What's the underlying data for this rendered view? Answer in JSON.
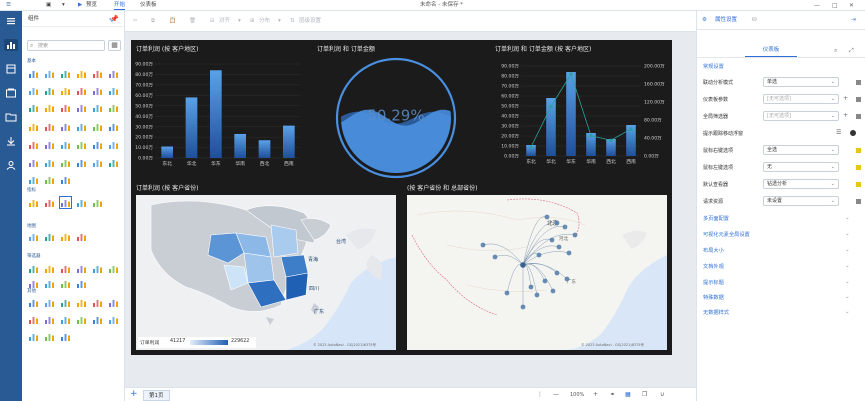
{
  "titlebar": {
    "menu": [
      "预览",
      "开始",
      "仪表板"
    ],
    "doc_title": "未命名 - 未保存 *",
    "window_controls": [
      "—",
      "□",
      "✕"
    ]
  },
  "left_rail": {
    "icons": [
      "menu-icon",
      "chart-icon",
      "dataset-icon",
      "schedule-icon",
      "folder-icon",
      "download-icon",
      "user-icon"
    ]
  },
  "components": {
    "title": "组件",
    "search_placeholder": "搜索",
    "sections": [
      "基本",
      "指标",
      "地图",
      "筛选器",
      "其他"
    ]
  },
  "toolbar": {
    "items": [
      "对齐",
      "分布",
      "层级设置"
    ]
  },
  "dashboard": {
    "colors": {
      "bg": "#1b1b1b",
      "bar": "#3f7fd6",
      "bar_light": "#5aa2e8",
      "line": "#2aa198",
      "water": "#4a90e0"
    },
    "chart_titles": {
      "c1": "订单利润 (按 客户地区)",
      "c2": "订单利润 和 订单金额",
      "c3": "订单利润 和 订单金额 (按 客户地区)",
      "c4": "订单利润 (按 客户省份)",
      "c5": "(按 客户省份 和 总部省份)"
    },
    "map_legend": {
      "label": "订单利润",
      "min": "41217",
      "max": "229622"
    },
    "map_attribution": "© 2023 AutoNavi - GS(2021)6375号",
    "map_labels": {
      "m1": [
        "青海",
        "四川",
        "广东",
        "台湾"
      ],
      "m2": [
        "北京",
        "河北",
        "广东"
      ]
    }
  },
  "chart_data": [
    {
      "type": "bar",
      "title": "订单利润 (按 客户地区)",
      "categories": [
        "东北",
        "华北",
        "华东",
        "华南",
        "西北",
        "西南"
      ],
      "yticks": [
        "0.00万",
        "10.00万",
        "20.00万",
        "30.00万",
        "40.00万",
        "50.00万",
        "60.00万",
        "70.00万",
        "80.00万",
        "90.00万"
      ],
      "values": [
        11,
        58,
        84,
        23,
        17,
        31
      ],
      "ylim": [
        0,
        90
      ]
    },
    {
      "type": "gauge",
      "title": "订单利润 和 订单金额",
      "value_label": "50.29%",
      "value": 0.5029
    },
    {
      "type": "bar",
      "title": "订单利润 和 订单金额 (按 客户地区)",
      "categories": [
        "东北",
        "华北",
        "华东",
        "华南",
        "西北",
        "西南"
      ],
      "yticks_left": [
        "0.00万",
        "10.00万",
        "20.00万",
        "30.00万",
        "40.00万",
        "50.00万",
        "60.00万",
        "70.00万",
        "80.00万",
        "90.00万"
      ],
      "yticks_right": [
        "0.00万",
        "40.00万",
        "80.00万",
        "120.00万",
        "160.00万",
        "200.00万"
      ],
      "series": [
        {
          "values": [
            11,
            58,
            84,
            23,
            17,
            31
          ]
        },
        {
          "values": [
            20,
            110,
            182,
            45,
            35,
            60
          ]
        }
      ],
      "ylim": [
        0,
        90
      ],
      "ylim_right": [
        0,
        200
      ]
    }
  ],
  "right_panel": {
    "tabs": [
      "属性设置"
    ],
    "subtab": "仪表板",
    "group_general": "常规设置",
    "rows": [
      {
        "label": "联动分析模式",
        "value": "单选",
        "placeholder": false
      },
      {
        "label": "仪表板参数",
        "value": "[无可选项]",
        "placeholder": true
      },
      {
        "label": "全局筛选器",
        "value": "[无可选项]",
        "placeholder": true
      },
      {
        "label": "提示跟踪移动浮窗",
        "value": "",
        "placeholder": false
      },
      {
        "label": "鼠标右键选项",
        "value": "全选",
        "placeholder": false
      },
      {
        "label": "鼠标左键选项",
        "value": "无",
        "placeholder": false
      },
      {
        "label": "默认查看器",
        "value": "钻透分析",
        "placeholder": false
      },
      {
        "label": "请求资源",
        "value": "未设置",
        "placeholder": false
      }
    ],
    "groups": [
      "多页面配置",
      "可视化元素全局设置",
      "布局大小",
      "文档外观",
      "提示标题",
      "特殊数据",
      "无数据样式"
    ]
  },
  "bottom": {
    "page_tab": "第1页",
    "zoom": "100%"
  }
}
